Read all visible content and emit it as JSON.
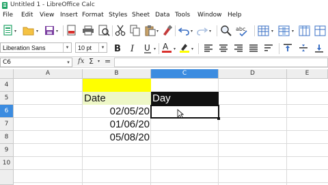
{
  "window": {
    "title": "Untitled 1 - LibreOffice Calc"
  },
  "menubar": {
    "items": [
      "File",
      "Edit",
      "View",
      "Insert",
      "Format",
      "Styles",
      "Sheet",
      "Data",
      "Tools",
      "Window",
      "Help"
    ]
  },
  "format_bar": {
    "font_name": "Liberation Sans",
    "font_size": "10 pt"
  },
  "formula_bar": {
    "name_box": "C6",
    "fx": "fx",
    "sigma": "Σ",
    "equals": "=",
    "formula": ""
  },
  "columns": [
    "A",
    "B",
    "C",
    "D",
    "E"
  ],
  "rows": [
    "4",
    "5",
    "6",
    "7",
    "8",
    "9",
    "10"
  ],
  "selected": {
    "column": "C",
    "row": "6"
  },
  "cells": {
    "B5": "Date",
    "C5": "Day",
    "B6": "02/05/20",
    "B7": "01/06/20",
    "B8": "05/08/20"
  },
  "colors": {
    "header_highlight": "#3c8ce0",
    "cell_yellow": "#ffff00",
    "cell_light_green": "#eef7c7",
    "cell_black": "#111111"
  },
  "icons": [
    "app-calc-icon",
    "new-document-icon",
    "open-folder-icon",
    "save-icon",
    "pdf-export-icon",
    "print-icon",
    "print-preview-icon",
    "cut-icon",
    "copy-icon",
    "paste-icon",
    "clone-format-icon",
    "undo-icon",
    "redo-icon",
    "find-replace-icon",
    "spelling-icon",
    "row-icon",
    "column-icon",
    "bold-icon",
    "italic-icon",
    "underline-icon",
    "font-color-icon",
    "highlight-icon",
    "border-icon",
    "align-left-icon",
    "align-center-icon",
    "align-right-icon",
    "justify-icon",
    "align-top-icon",
    "align-middle-icon",
    "align-bottom-icon"
  ]
}
